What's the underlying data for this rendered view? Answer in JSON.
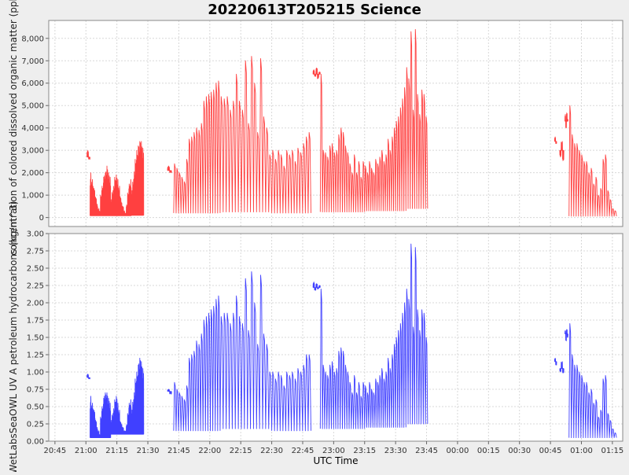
{
  "title": "20220613T205215 Science",
  "xlabel": "UTC Time",
  "colors": {
    "background": "#eeeeee",
    "plot_bg": "#ffffff",
    "grid": "#d8d8d8",
    "frame": "#888888",
    "cdom": "#ff4040",
    "petro": "#4040ff"
  },
  "x_ticks": [
    "20:45",
    "21:00",
    "21:15",
    "21:30",
    "21:45",
    "22:00",
    "22:15",
    "22:30",
    "22:45",
    "23:00",
    "23:15",
    "23:30",
    "23:45",
    "00:00",
    "00:15",
    "00:30",
    "00:45",
    "01:00",
    "01:15",
    "01:30"
  ],
  "chart_data": [
    {
      "type": "line",
      "title": "20220613T205215 Science",
      "xlabel": "UTC Time",
      "ylabel": "concentration of colored dissolved organic matter (ppb)",
      "x_unit": "minutes after 20:45 UTC",
      "xlim": [
        -3,
        275
      ],
      "ylim": [
        -400,
        8800
      ],
      "y_ticks": [
        0,
        1000,
        2000,
        3000,
        4000,
        5000,
        6000,
        7000,
        8000
      ],
      "y_tick_labels": [
        "0",
        "1,000",
        "2,000",
        "3,000",
        "4,000",
        "5,000",
        "6,000",
        "7,000",
        "8,000"
      ],
      "grid": true,
      "series": [
        {
          "color": "#ff4040",
          "segments": [
            {
              "start": 15.5,
              "end": 17.0,
              "base": 2700,
              "dense": true,
              "peaks": [
                3000,
                2600
              ]
            },
            {
              "start": 17.0,
              "end": 27.0,
              "base": 80,
              "dense": true,
              "peaks": [
                2000,
                1700,
                1500,
                1300,
                900,
                600,
                400,
                300,
                1000,
                1400,
                1800,
                2000,
                2200,
                2300,
                2000,
                1800
              ]
            },
            {
              "start": 27.0,
              "end": 37.0,
              "base": 80,
              "dense": true,
              "peaks": [
                800,
                1200,
                1500,
                1800,
                1900,
                1700,
                1400,
                1000,
                700,
                500,
                300,
                200,
                600,
                1100,
                1500,
                1700
              ]
            },
            {
              "start": 37.0,
              "end": 43.0,
              "base": 100,
              "dense": true,
              "peaks": [
                1200,
                1700,
                2200,
                2600,
                3000,
                3200,
                3400,
                3600,
                3400,
                3100
              ]
            },
            {
              "start": 54.5,
              "end": 56.5,
              "base": 2100,
              "dense": true,
              "peaks": [
                2300,
                2000
              ]
            },
            {
              "start": 57.5,
              "end": 80.0,
              "base": 200,
              "dense": false,
              "peaks": [
                2400,
                2200,
                2000,
                1800,
                1600,
                2600,
                3500,
                3600,
                3800,
                4000,
                3900,
                4200,
                5200,
                5400,
                5500,
                5600,
                5700,
                6000,
                6100
              ]
            },
            {
              "start": 80.0,
              "end": 105.0,
              "base": 250,
              "dense": false,
              "peaks": [
                5400,
                5300,
                5400,
                4800,
                5200,
                6400,
                5200,
                4800,
                7000,
                4200,
                7200,
                6000,
                3800,
                7100,
                4500,
                4000,
                2800
              ]
            },
            {
              "start": 105.0,
              "end": 124.0,
              "base": 200,
              "dense": false,
              "peaks": [
                3000,
                2600,
                3000,
                2800,
                2300,
                3000,
                2800,
                3000,
                2500,
                3100,
                2900,
                3300,
                3600,
                3800
              ]
            },
            {
              "start": 125.0,
              "end": 128.5,
              "base": 6400,
              "dense": true,
              "peaks": [
                6600,
                6300,
                6700,
                6200,
                6500
              ]
            },
            {
              "start": 128.5,
              "end": 150.0,
              "base": 250,
              "dense": false,
              "peaks": [
                6400,
                3000,
                2900,
                2700,
                3200,
                3300,
                2900,
                3000,
                3700,
                4000,
                3800,
                3200,
                2900,
                2400,
                2000,
                2800,
                2000,
                2500,
                1800,
                2500
              ]
            },
            {
              "start": 150.0,
              "end": 170.0,
              "base": 300,
              "dense": false,
              "peaks": [
                2300,
                2000,
                2500,
                2200,
                2000,
                2600,
                2400,
                2700,
                3000,
                2500,
                2800,
                3500,
                3000,
                3600,
                4000,
                4300,
                4500,
                4900,
                5300,
                5800
              ]
            },
            {
              "start": 170.0,
              "end": 180.5,
              "base": 400,
              "dense": false,
              "peaks": [
                6700,
                6200,
                8300,
                4800,
                8400,
                5500,
                4600,
                5700,
                5500,
                4500
              ]
            },
            {
              "start": 242.0,
              "end": 243.0,
              "base": 3400,
              "dense": true,
              "peaks": [
                3600,
                3300
              ]
            },
            {
              "start": 244.5,
              "end": 246.5,
              "base": 3000,
              "dense": true,
              "peaks": [
                2700,
                3400,
                2500
              ]
            },
            {
              "start": 247.0,
              "end": 248.5,
              "base": 4300,
              "dense": true,
              "peaks": [
                4600,
                4000,
                4700,
                4400
              ]
            },
            {
              "start": 249.0,
              "end": 272.0,
              "base": 60,
              "dense": false,
              "peaks": [
                5000,
                3700,
                3300,
                3300,
                3000,
                2800,
                2500,
                2500,
                2000,
                2200,
                1500,
                1800,
                1000,
                1300,
                2600,
                2800,
                1200,
                800,
                400,
                300
              ]
            }
          ]
        }
      ]
    },
    {
      "type": "line",
      "ylabel": "WetLabsSeaOWL UV A petroleum hydrocarbons (kg/m^3)",
      "x_unit": "minutes after 20:45 UTC",
      "xlim": [
        -3,
        275
      ],
      "ylim": [
        0,
        3.0
      ],
      "y_ticks": [
        0,
        0.25,
        0.5,
        0.75,
        1.0,
        1.25,
        1.5,
        1.75,
        2.0,
        2.25,
        2.5,
        2.75,
        3.0
      ],
      "y_tick_labels": [
        "0.00",
        "0.25",
        "0.50",
        "0.75",
        "1.00",
        "1.25",
        "1.50",
        "1.75",
        "2.00",
        "2.25",
        "2.50",
        "2.75",
        "3.00"
      ],
      "grid": true,
      "series": [
        {
          "color": "#4040ff",
          "segments": [
            {
              "start": 15.5,
              "end": 17.0,
              "base": 0.92,
              "dense": true,
              "peaks": [
                0.97,
                0.9
              ]
            },
            {
              "start": 17.0,
              "end": 27.0,
              "base": 0.05,
              "dense": true,
              "peaks": [
                0.65,
                0.55,
                0.5,
                0.45,
                0.3,
                0.2,
                0.15,
                0.1,
                0.35,
                0.5,
                0.62,
                0.7,
                0.72,
                0.7,
                0.62,
                0.55
              ]
            },
            {
              "start": 27.0,
              "end": 37.0,
              "base": 0.1,
              "dense": true,
              "peaks": [
                0.3,
                0.4,
                0.5,
                0.6,
                0.65,
                0.55,
                0.45,
                0.3,
                0.25,
                0.2,
                0.15,
                0.15,
                0.25,
                0.4,
                0.55,
                0.6
              ]
            },
            {
              "start": 37.0,
              "end": 43.0,
              "base": 0.1,
              "dense": true,
              "peaks": [
                0.45,
                0.6,
                0.75,
                0.9,
                1.0,
                1.1,
                1.2,
                1.25,
                1.15,
                1.05
              ]
            },
            {
              "start": 54.5,
              "end": 56.5,
              "base": 0.72,
              "dense": true,
              "peaks": [
                0.75,
                0.68
              ]
            },
            {
              "start": 57.5,
              "end": 80.0,
              "base": 0.15,
              "dense": false,
              "peaks": [
                0.85,
                0.75,
                0.7,
                0.65,
                0.6,
                0.8,
                1.2,
                1.25,
                1.3,
                1.45,
                1.4,
                1.55,
                1.75,
                1.8,
                1.85,
                1.9,
                1.95,
                2.05,
                2.1
              ]
            },
            {
              "start": 80.0,
              "end": 105.0,
              "base": 0.18,
              "dense": false,
              "peaks": [
                1.8,
                1.85,
                1.85,
                1.7,
                1.85,
                2.1,
                1.8,
                1.7,
                2.35,
                1.6,
                2.45,
                2.0,
                1.4,
                2.4,
                1.55,
                1.4,
                1.0
              ]
            },
            {
              "start": 105.0,
              "end": 124.0,
              "base": 0.15,
              "dense": false,
              "peaks": [
                1.0,
                0.9,
                1.0,
                0.95,
                0.8,
                1.0,
                0.95,
                1.0,
                0.9,
                1.05,
                1.0,
                1.1,
                1.25,
                1.25
              ]
            },
            {
              "start": 125.0,
              "end": 128.5,
              "base": 2.22,
              "dense": true,
              "peaks": [
                2.3,
                2.18,
                2.28,
                2.2,
                2.25
              ]
            },
            {
              "start": 128.5,
              "end": 150.0,
              "base": 0.18,
              "dense": false,
              "peaks": [
                2.2,
                1.1,
                1.0,
                0.95,
                1.1,
                1.15,
                1.0,
                1.05,
                1.3,
                1.35,
                1.3,
                1.1,
                1.0,
                0.85,
                0.7,
                0.95,
                0.7,
                0.85,
                0.65,
                0.85
              ]
            },
            {
              "start": 150.0,
              "end": 170.0,
              "base": 0.2,
              "dense": false,
              "peaks": [
                0.8,
                0.7,
                0.85,
                0.75,
                0.7,
                0.9,
                0.85,
                0.95,
                1.05,
                0.9,
                1.0,
                1.2,
                1.05,
                1.25,
                1.4,
                1.5,
                1.6,
                1.7,
                1.85,
                2.0
              ]
            },
            {
              "start": 170.0,
              "end": 180.5,
              "base": 0.25,
              "dense": false,
              "peaks": [
                2.2,
                2.05,
                2.85,
                1.65,
                2.8,
                1.9,
                1.6,
                1.9,
                1.85,
                1.5
              ]
            },
            {
              "start": 242.0,
              "end": 243.0,
              "base": 1.15,
              "dense": true,
              "peaks": [
                1.2,
                1.1
              ]
            },
            {
              "start": 244.5,
              "end": 246.5,
              "base": 1.05,
              "dense": true,
              "peaks": [
                1.0,
                1.15,
                0.98
              ]
            },
            {
              "start": 247.0,
              "end": 248.5,
              "base": 1.55,
              "dense": true,
              "peaks": [
                1.6,
                1.45,
                1.62,
                1.5
              ]
            },
            {
              "start": 249.0,
              "end": 272.0,
              "base": 0.05,
              "dense": false,
              "peaks": [
                1.7,
                1.25,
                1.1,
                1.1,
                1.0,
                0.95,
                0.85,
                0.85,
                0.7,
                0.75,
                0.55,
                0.6,
                0.35,
                0.45,
                0.9,
                0.95,
                0.4,
                0.3,
                0.18,
                0.12
              ]
            }
          ]
        }
      ]
    }
  ]
}
